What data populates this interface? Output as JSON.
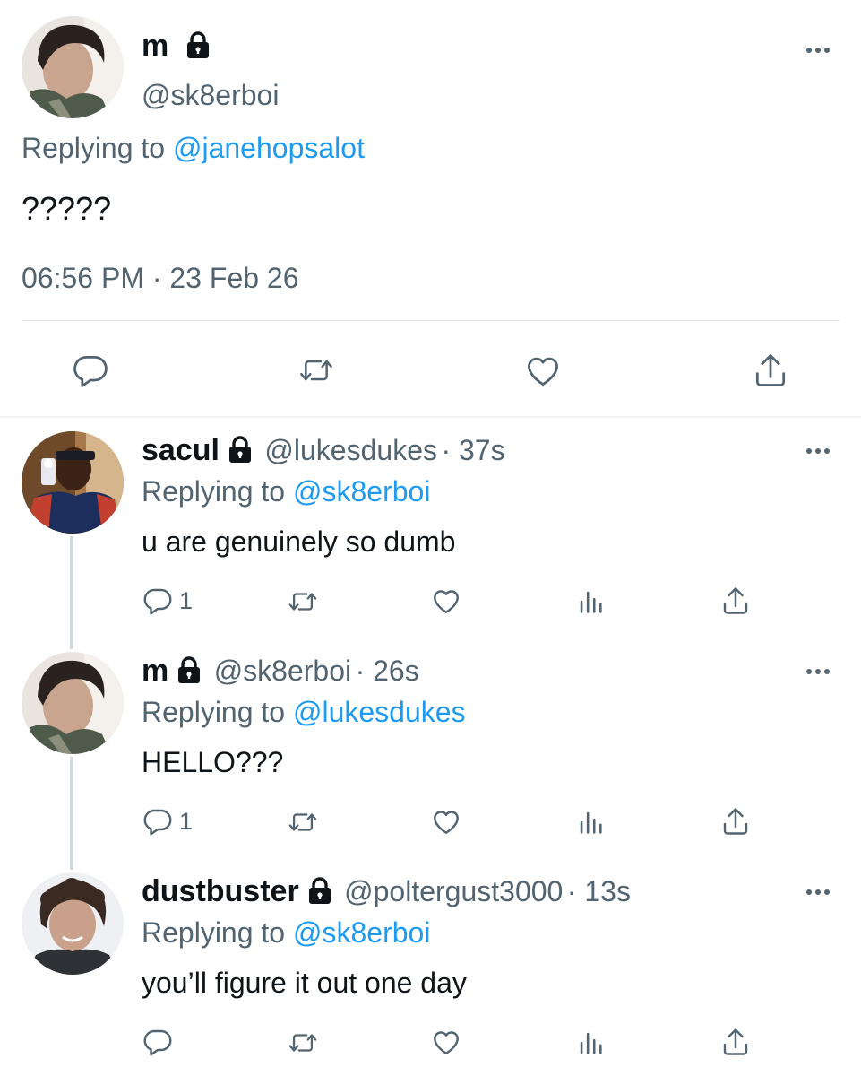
{
  "main_tweet": {
    "name": "m",
    "handle": "@sk8erboi",
    "replying_prefix": "Replying to ",
    "replying_to": "@janehopsalot",
    "text": "?????",
    "timestamp": "06:56 PM · 23 Feb 26"
  },
  "replies": [
    {
      "name": "sacul",
      "handle": "@lukesdukes",
      "time": "· 37s",
      "replying_prefix": "Replying to ",
      "replying_to": "@sk8erboi",
      "text": "u are genuinely so dumb",
      "reply_count": "1"
    },
    {
      "name": "m",
      "handle": "@sk8erboi",
      "time": "· 26s",
      "replying_prefix": "Replying to ",
      "replying_to": "@lukesdukes",
      "text": "HELLO???",
      "reply_count": "1"
    },
    {
      "name": "dustbuster",
      "handle": "@poltergust3000",
      "time": "· 13s",
      "replying_prefix": "Replying to ",
      "replying_to": "@sk8erboi",
      "text": "you’ll figure it out one day",
      "reply_count": ""
    }
  ],
  "icons": {
    "reply": "reply-icon",
    "retweet": "retweet-icon",
    "like": "heart-icon",
    "analytics": "analytics-icon",
    "share": "share-icon",
    "more": "more-icon",
    "lock": "lock-icon"
  },
  "colors": {
    "accent": "#1d9bf0",
    "secondary_text": "#536471",
    "primary_text": "#0f1419",
    "divider": "#e1e4e8",
    "thread_line": "#cfd9de"
  }
}
